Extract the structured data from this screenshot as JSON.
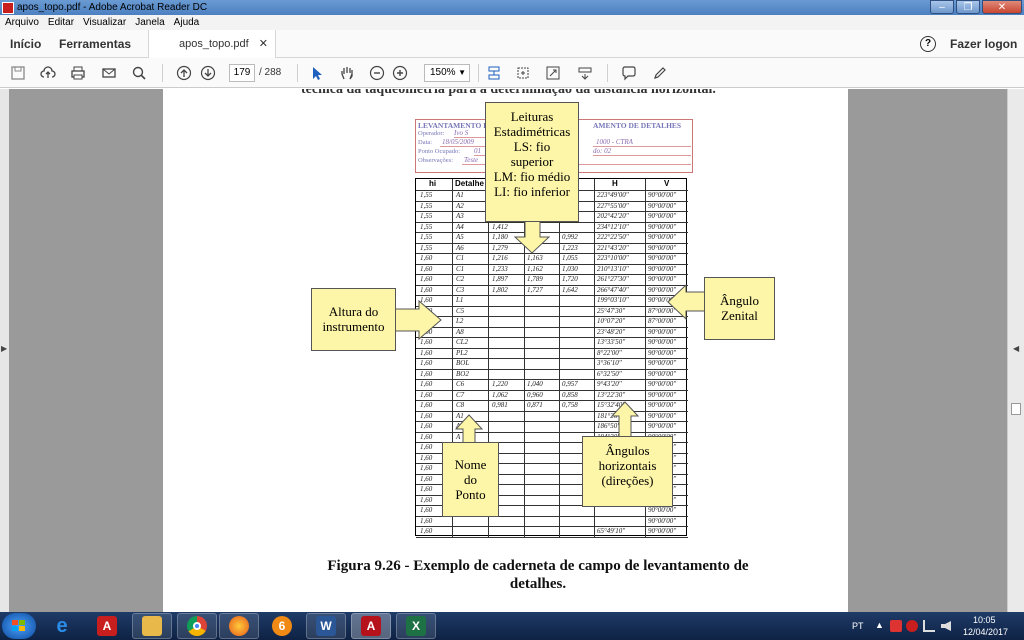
{
  "window": {
    "title": "apos_topo.pdf - Adobe Acrobat Reader DC"
  },
  "menu": [
    "Arquivo",
    "Editar",
    "Visualizar",
    "Janela",
    "Ajuda"
  ],
  "tabs": {
    "home": "Início",
    "tools": "Ferramentas",
    "document": "apos_topo.pdf",
    "login": "Fazer logon"
  },
  "toolbar": {
    "page_current": "179",
    "page_total": "/ 288",
    "zoom": "150%"
  },
  "document": {
    "top_text": "técnica da taqueometria para a determinação da distância horizontal.",
    "form": {
      "title_left": "LEVANTAMENTO E",
      "title_right": "AMENTO DE DETALHES",
      "labels": [
        "Operador:",
        "Data:",
        "Ponto Ocupado:",
        "Observações:"
      ],
      "values": [
        "Ivo S",
        "18/05/2009",
        "01",
        "Teste"
      ],
      "right_values": [
        "1000 - CTRA",
        "do: 02"
      ]
    },
    "table": {
      "headers": [
        "hi",
        "Detalhe",
        "LS",
        "LM",
        "LI",
        "H",
        "V"
      ],
      "rows": [
        [
          "1,55",
          "A1",
          "",
          "",
          "",
          "223°49'00\"",
          "90°00'00\""
        ],
        [
          "1,55",
          "A2",
          "",
          "",
          "",
          "227°55'00\"",
          "90°00'00\""
        ],
        [
          "1,55",
          "A3",
          "",
          "",
          "",
          "202°42'20\"",
          "90°00'00\""
        ],
        [
          "1,55",
          "A4",
          "1,412",
          "",
          "",
          "234°12'10\"",
          "90°00'00\""
        ],
        [
          "1,55",
          "A5",
          "1,180",
          "",
          "0,992",
          "222°22'50\"",
          "90°00'00\""
        ],
        [
          "1,55",
          "A6",
          "1,279",
          "",
          "1,223",
          "221°43'20\"",
          "90°00'00\""
        ],
        [
          "1,60",
          "C1",
          "1,216",
          "1,163",
          "1,055",
          "223°10'00\"",
          "90°00'00\""
        ],
        [
          "1,60",
          "C1",
          "1,233",
          "1,162",
          "1,030",
          "210°13'10\"",
          "90°00'00\""
        ],
        [
          "1,60",
          "C2",
          "1,897",
          "1,789",
          "1,720",
          "261°27'30\"",
          "90°00'00\""
        ],
        [
          "1,60",
          "C3",
          "1,802",
          "1,727",
          "1,642",
          "266°47'40\"",
          "90°00'00\""
        ],
        [
          "1,60",
          "L1",
          "",
          "",
          "",
          "199°03'10\"",
          "90°00'00\""
        ],
        [
          "1,60",
          "C5",
          "",
          "",
          "",
          "25°47'30\"",
          "87°00'00\""
        ],
        [
          "1,60",
          "L2",
          "",
          "",
          "",
          "10°07'20\"",
          "87°00'00\""
        ],
        [
          "1,60",
          "A8",
          "",
          "",
          "",
          "23°48'20\"",
          "90°00'00\""
        ],
        [
          "1,60",
          "CL2",
          "",
          "",
          "",
          "13°33'50\"",
          "90°00'00\""
        ],
        [
          "1,60",
          "PL2",
          "",
          "",
          "",
          "8°22'00\"",
          "90°00'00\""
        ],
        [
          "1,60",
          "BOL",
          "",
          "",
          "",
          "3°36'10\"",
          "90°00'00\""
        ],
        [
          "1,60",
          "BO2",
          "",
          "",
          "",
          "6°32'50\"",
          "90°00'00\""
        ],
        [
          "1,60",
          "C6",
          "1,220",
          "1,040",
          "0,957",
          "9°43'20\"",
          "90°00'00\""
        ],
        [
          "1,60",
          "C7",
          "1,062",
          "0,960",
          "0,858",
          "13°22'30\"",
          "90°00'00\""
        ],
        [
          "1,60",
          "C8",
          "0,981",
          "0,871",
          "0,758",
          "15°32'40\"",
          "90°00'00\""
        ],
        [
          "1,60",
          "A1",
          "",
          "",
          "",
          "181°26'40\"",
          "90°00'00\""
        ],
        [
          "1,60",
          "A1",
          "",
          "",
          "",
          "186°50'20\"",
          "90°00'00\""
        ],
        [
          "1,60",
          "A",
          "",
          "",
          "",
          "194°30'00\"",
          "90°00'00\""
        ],
        [
          "1,60",
          "A",
          "",
          "",
          "",
          "195°30'00\"",
          "90°00'00\""
        ],
        [
          "1,60",
          "",
          "",
          "",
          "",
          "",
          "90°00'00\""
        ],
        [
          "1,60",
          "",
          "",
          "",
          "",
          "",
          "90°00'00\""
        ],
        [
          "1,60",
          "",
          "",
          "",
          "",
          "",
          "90°00'00\""
        ],
        [
          "1,60",
          "",
          "",
          "",
          "",
          "",
          "90°00'00\""
        ],
        [
          "1,60",
          "",
          "",
          "",
          "",
          "",
          "90°00'00\""
        ],
        [
          "1,60",
          "",
          "",
          "",
          "",
          "",
          "90°00'00\""
        ],
        [
          "1,60",
          "",
          "",
          "",
          "",
          "",
          "90°00'00\""
        ],
        [
          "1,60",
          "",
          "",
          "",
          "",
          "65°49'10\"",
          "90°00'00\""
        ]
      ]
    },
    "callouts": {
      "leituras": [
        "Leituras",
        "Estadimétricas",
        "LS: fio",
        "superior",
        "LM: fio médio",
        "LI: fio inferior"
      ],
      "altura": [
        "Altura do",
        "instrumento"
      ],
      "angulo_zenital": [
        "Ângulo",
        "Zenital"
      ],
      "nome_ponto": [
        "Nome",
        "do",
        "Ponto"
      ],
      "angulos_horizontais": [
        "Ângulos",
        "horizontais",
        "(direções)"
      ]
    },
    "caption": [
      "Figura 9.26 - Exemplo de caderneta de campo de levantamento de",
      "detalhes."
    ]
  },
  "taskbar": {
    "lang": "PT",
    "time": "10:05",
    "date": "12/04/2017"
  }
}
